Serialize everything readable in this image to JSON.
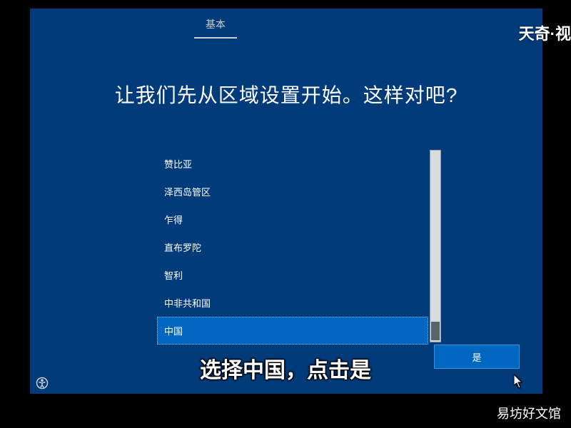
{
  "tab_label": "基本",
  "heading": "让我们先从区域设置开始。这样对吧?",
  "regions": {
    "items": [
      "赞比亚",
      "泽西岛管区",
      "乍得",
      "直布罗陀",
      "智利",
      "中非共和国",
      "中国"
    ],
    "selected_index": 6
  },
  "buttons": {
    "yes": "是"
  },
  "subtitle": "选择中国，点击是",
  "watermarks": {
    "top_right": "天奇·视",
    "bottom_right": "易坊好文馆"
  }
}
